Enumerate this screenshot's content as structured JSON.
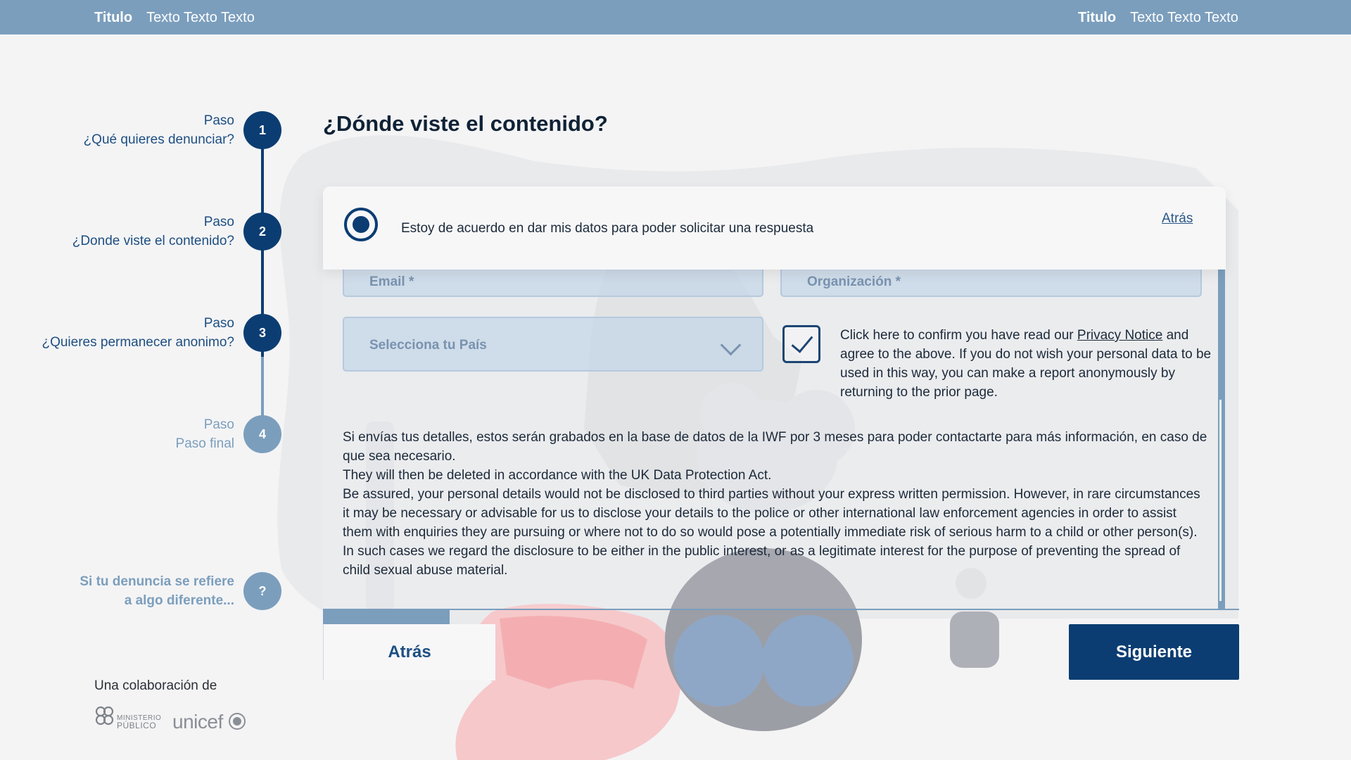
{
  "topbar": {
    "left": {
      "title": "Titulo",
      "text": "Texto Texto Texto"
    },
    "right": {
      "title": "Titulo",
      "text": "Texto Texto Texto"
    }
  },
  "steps": [
    {
      "label": "Paso",
      "name": "¿Qué quieres denunciar?",
      "number": "1",
      "status": "completed"
    },
    {
      "label": "Paso",
      "name": "¿Donde viste el contenido?",
      "number": "2",
      "status": "completed"
    },
    {
      "label": "Paso",
      "name": "¿Quieres permanecer anonimo?",
      "number": "3",
      "status": "current"
    },
    {
      "label": "Paso",
      "name": "Paso final",
      "number": "4",
      "status": "upcoming"
    }
  ],
  "help": {
    "line1": "Si tu denuncia se refiere",
    "line2": "a algo diferente...",
    "icon_text": "?"
  },
  "main": {
    "title": "¿Dónde viste el contenido?"
  },
  "card": {
    "consent_text": "Estoy de acuerdo en dar mis datos para poder solicitar una respuesta",
    "back_link": "Atrás",
    "email_placeholder": "Email *",
    "organization_placeholder": "Organización *",
    "country_placeholder": "Selecciona tu País",
    "privacy_before": "Click here to confirm you have read our ",
    "privacy_link": "Privacy Notice",
    "privacy_after": " and agree to the above. If you do not wish your personal data to be used in this way, you can make a report anonymously by returning to the prior page.",
    "info_1": "Si envías tus detalles, estos serán grabados en la base de datos de la IWF por 3 meses para poder contactarte para más información, en caso de que sea necesario.",
    "info_2": "They will then be deleted in accordance with the UK Data Protection Act.",
    "info_3": "Be assured, your personal details would not be disclosed to third parties without your express written permission. However, in rare circumstances it may be necessary or advisable for us to disclose your details to the police or other international law enforcement agencies in order to assist them with enquiries they are pursuing or where not to do so would pose a potentially immediate risk of serious harm to a child or other person(s). In such cases we regard the disclosure to be either in the public interest, or as a legitimate interest for the purpose of preventing the spread of child sexual abuse material."
  },
  "buttons": {
    "back": "Atrás",
    "next": "Siguiente"
  },
  "footer": {
    "collab": "Una colaboración de",
    "logo_1_line1": "MINISTERIO",
    "logo_1_line2": "PÚBLICO",
    "logo_2": "unicef"
  },
  "colors": {
    "primary": "#0b3d72",
    "topbar": "#7b9ebd",
    "inactive": "#7b9ebd",
    "background": "#f4f4f5"
  }
}
